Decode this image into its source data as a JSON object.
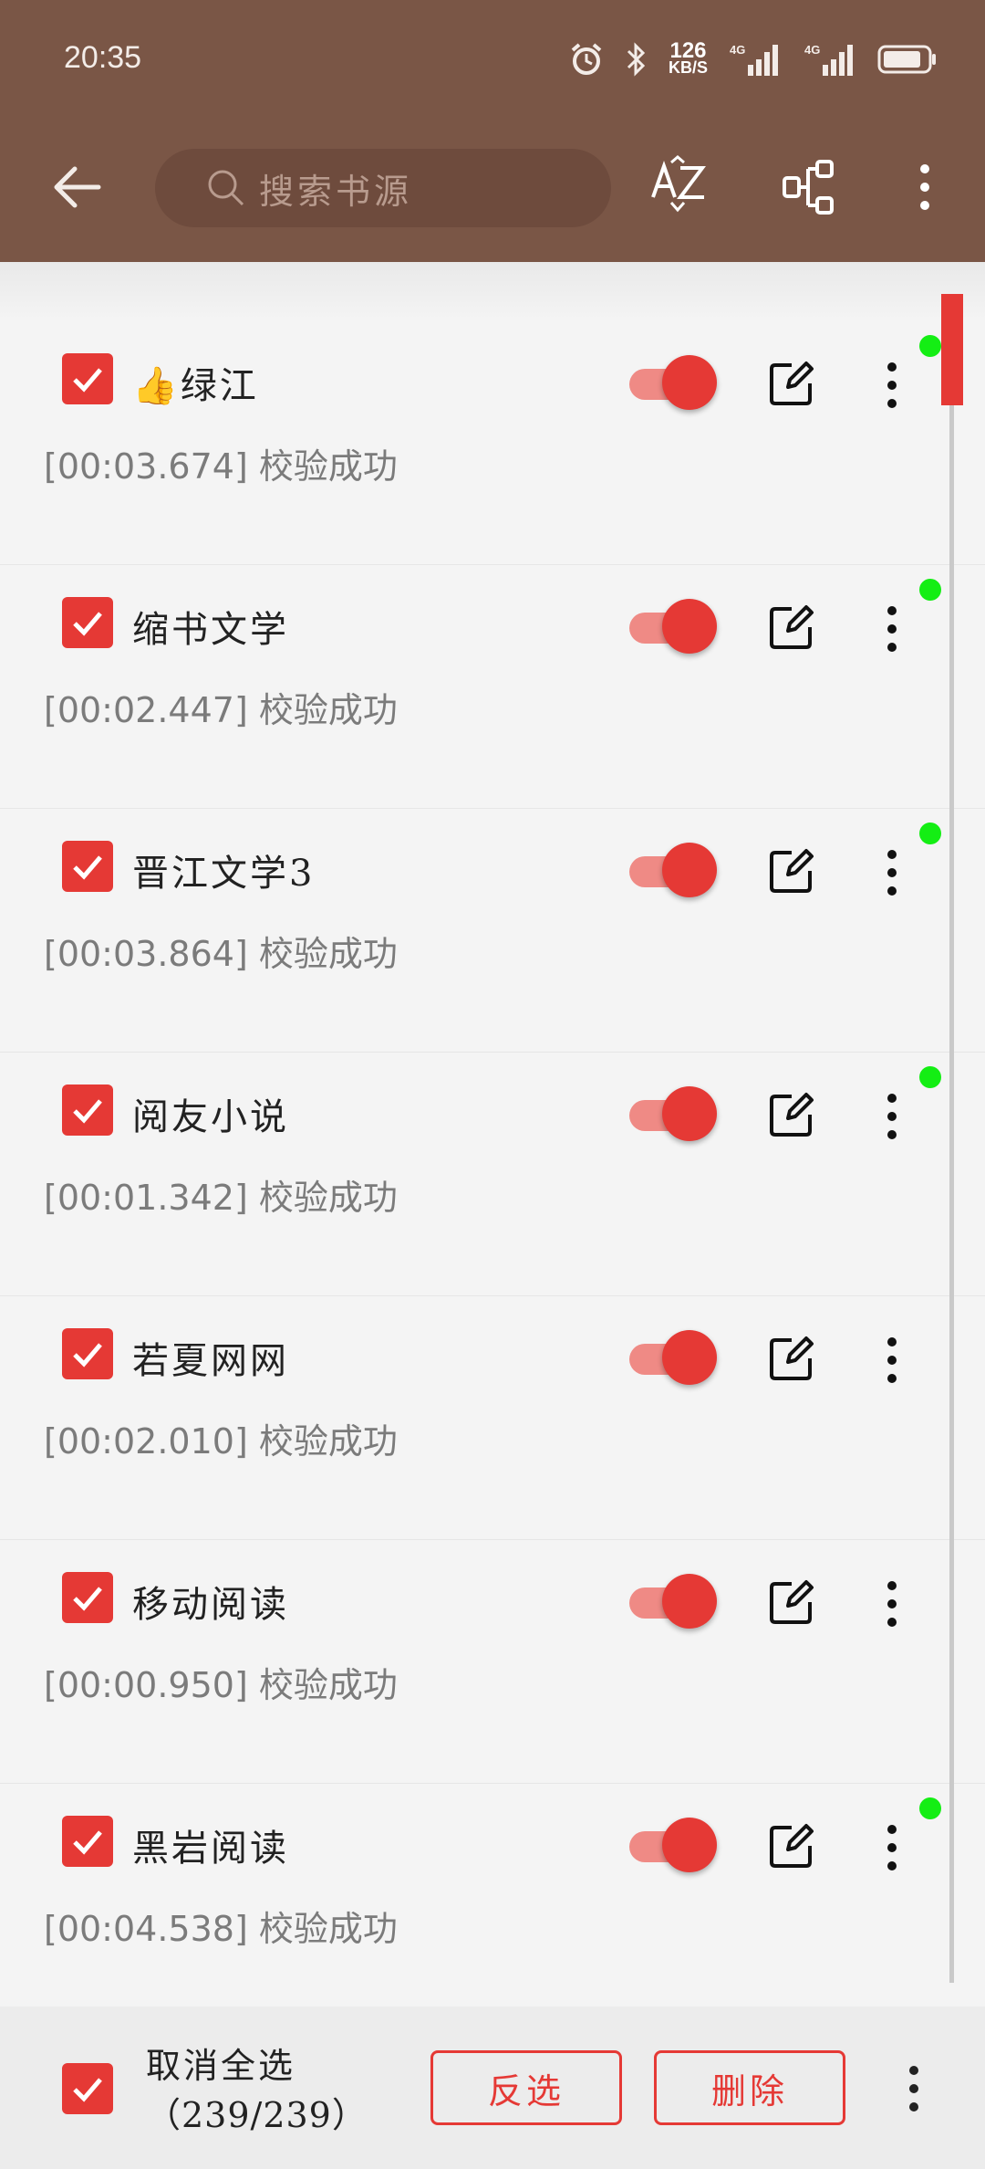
{
  "status_bar": {
    "time": "20:35",
    "net_speed_value": "126",
    "net_speed_unit": "KB/S",
    "signal1_label": "4G",
    "signal2_label": "4G"
  },
  "toolbar": {
    "search_placeholder": "搜索书源",
    "sort_icon": "az-sort-icon",
    "group_icon": "group-icon"
  },
  "sources": [
    {
      "emoji": "👍",
      "name": "绿江",
      "status": "[00:03.674] 校验成功",
      "enabled": true,
      "checked": true,
      "online": true
    },
    {
      "emoji": "",
      "name": "缩书文学",
      "status": "[00:02.447] 校验成功",
      "enabled": true,
      "checked": true,
      "online": true
    },
    {
      "emoji": "",
      "name": "晋江文学3",
      "status": "[00:03.864] 校验成功",
      "enabled": true,
      "checked": true,
      "online": true
    },
    {
      "emoji": "",
      "name": "阅友小说",
      "status": "[00:01.342] 校验成功",
      "enabled": true,
      "checked": true,
      "online": true
    },
    {
      "emoji": "",
      "name": "若夏网网",
      "status": "[00:02.010] 校验成功",
      "enabled": true,
      "checked": true,
      "online": false
    },
    {
      "emoji": "",
      "name": "移动阅读",
      "status": "[00:00.950] 校验成功",
      "enabled": true,
      "checked": true,
      "online": false
    },
    {
      "emoji": "",
      "name": "黑岩阅读",
      "status": "[00:04.538] 校验成功",
      "enabled": true,
      "checked": true,
      "online": true
    }
  ],
  "bottom_bar": {
    "select_label": "取消全选",
    "select_count": "（239/239）",
    "invert_button": "反选",
    "delete_button": "删除"
  },
  "colors": {
    "header": "#7a5646",
    "accent": "#e53935",
    "online_dot": "#14ee14"
  }
}
